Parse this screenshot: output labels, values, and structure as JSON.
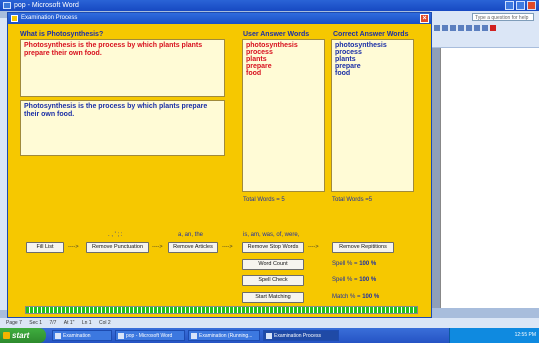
{
  "word": {
    "title": "pop - Microsoft Word",
    "help_placeholder": "Type a question for help",
    "status": [
      "Page 7",
      "Sec 1",
      "7/7",
      "At 1\"",
      "Ln 1",
      "Col 2"
    ]
  },
  "taskbar": {
    "start": "start",
    "items": [
      "Examination",
      "pop - Microsoft Word",
      "Examination (Running...",
      "Examination Process"
    ],
    "clock": "12:55 PM"
  },
  "dialog": {
    "title": "Examination Process",
    "question_label": "What is Photosynthesis?",
    "user_answer_label": "User Answer Words",
    "correct_answer_label": "Correct Answer Words",
    "user_text": "Photosynthesis is the process by which plants plants prepare their own food.",
    "correct_text": "Photosynthesis is the process by which plants prepare their own food.",
    "user_words": [
      "photosynthesis",
      "process",
      "plants",
      "prepare",
      "food"
    ],
    "correct_words": [
      "photosynthesis",
      "process",
      "plants",
      "prepare",
      "food"
    ],
    "user_total": "Total Words = 5",
    "correct_total": "Total Words =5",
    "punct_label": ". , ' ; :",
    "articles_label": "a, an, the",
    "stopwords_label": "is, am, was, of, were,",
    "arrow": "---->",
    "buttons": {
      "fill_list": "Fill List",
      "remove_punctuation": "Remove Punctuation",
      "remove_articles": "Remove Articles",
      "remove_stop_words": "Remove Stop Words",
      "remove_repetitions": "Remove Repititions",
      "word_count": "Word Count",
      "spell_check": "Spell Check",
      "start_matching": "Start Matching"
    },
    "spell1_label": "Spell % =",
    "spell1_value": "100 %",
    "spell2_label": "Spell % =",
    "spell2_value": "100 %",
    "match_label": "Match % =",
    "match_value": "100 %",
    "progress": 1.0
  }
}
